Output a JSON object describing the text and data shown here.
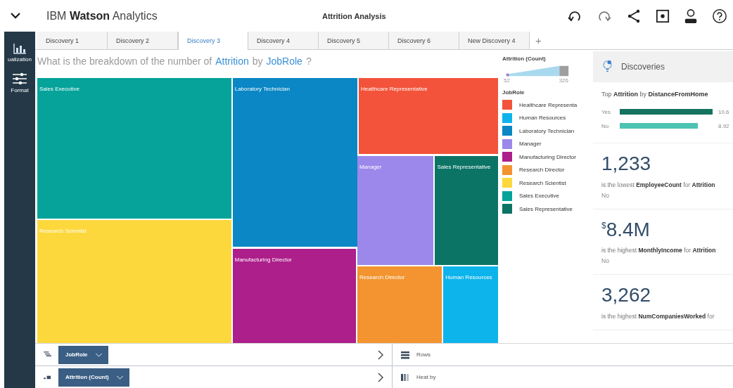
{
  "header": {
    "brand": "IBM **Watson** Analytics",
    "title": "Attrition Analysis"
  },
  "sidebar": [
    {
      "label": "ualization",
      "kind": "chart"
    },
    {
      "label": "Format",
      "kind": "sliders"
    }
  ],
  "tabs": [
    {
      "label": "Discovery 1",
      "selected": false
    },
    {
      "label": "Discovery 2",
      "selected": false
    },
    {
      "label": "Discovery 3",
      "selected": true
    },
    {
      "label": "Discovery 4",
      "selected": false
    },
    {
      "label": "Discovery 5",
      "selected": false
    },
    {
      "label": "Discovery 6",
      "selected": false
    },
    {
      "label": "New Discovery 4",
      "selected": false
    }
  ],
  "add_tab": "+",
  "question": {
    "parts": [
      {
        "text": "What is the breakdown of the number of",
        "kind": "plain"
      },
      {
        "text": "Attrition",
        "kind": "field"
      },
      {
        "text": "by",
        "kind": "plain"
      },
      {
        "text": "JobRole",
        "kind": "field"
      },
      {
        "text": "?",
        "kind": "plain"
      }
    ]
  },
  "treemap": {
    "tiles": [
      {
        "label": "Sales Executive",
        "color": "#05a39a"
      },
      {
        "label": "Laboratory Technician",
        "color": "#0a87c4"
      },
      {
        "label": "Healthcare Representative",
        "color": "#f2533a"
      },
      {
        "label": "Manager",
        "color": "#9b88ea"
      },
      {
        "label": "Sales Representative",
        "color": "#0b7465"
      },
      {
        "label": "Research Scientist",
        "color": "#fdd83d"
      },
      {
        "label": "Manufacturing Director",
        "color": "#ad1f8a"
      },
      {
        "label": "Research Director",
        "color": "#f39430"
      },
      {
        "label": "Human Resources",
        "color": "#0db4ec"
      }
    ]
  },
  "legend": {
    "size_title": "Attrition (Count)",
    "min": "52",
    "max": "326",
    "color_title": "JobRole",
    "items": [
      {
        "label": "Healthcare Representa",
        "color": "#f2533a"
      },
      {
        "label": "Human Resources",
        "color": "#0db4ec"
      },
      {
        "label": "Laboratory Technician",
        "color": "#0a87c4"
      },
      {
        "label": "Manager",
        "color": "#9b88ea"
      },
      {
        "label": "Manufacturing Director",
        "color": "#ad1f8a"
      },
      {
        "label": "Research Director",
        "color": "#f39430"
      },
      {
        "label": "Research Scientist",
        "color": "#fdd83d"
      },
      {
        "label": "Sales Executive",
        "color": "#05a39a"
      },
      {
        "label": "Sales Representative",
        "color": "#0b7465"
      }
    ]
  },
  "discoveries": {
    "title": "Discoveries",
    "top": {
      "caption": "Top **Attrition** by **DistanceFromHome**",
      "bars": [
        {
          "label": "Yes",
          "value": "10.6",
          "color": "#15735f"
        },
        {
          "label": "No",
          "value": "8.92",
          "color": "#4cc3b3"
        }
      ]
    },
    "cards": [
      {
        "value": "1,233",
        "text": "is the lowest **EmployeeCount** for **Attrition**",
        "sub": "No"
      },
      {
        "currency": "$",
        "value": "8.4M",
        "text": "is the highest **MonthlyIncome** for **Attrition**",
        "sub": "No"
      },
      {
        "value": "3,262",
        "text": "is the highest **NumCompaniesWorked** for"
      }
    ]
  },
  "slots": [
    {
      "value": "JobRole",
      "target": "Rows",
      "kind": "rows"
    },
    {
      "value": "Attrition (Count)",
      "target": "Heat by",
      "kind": "heat"
    }
  ]
}
